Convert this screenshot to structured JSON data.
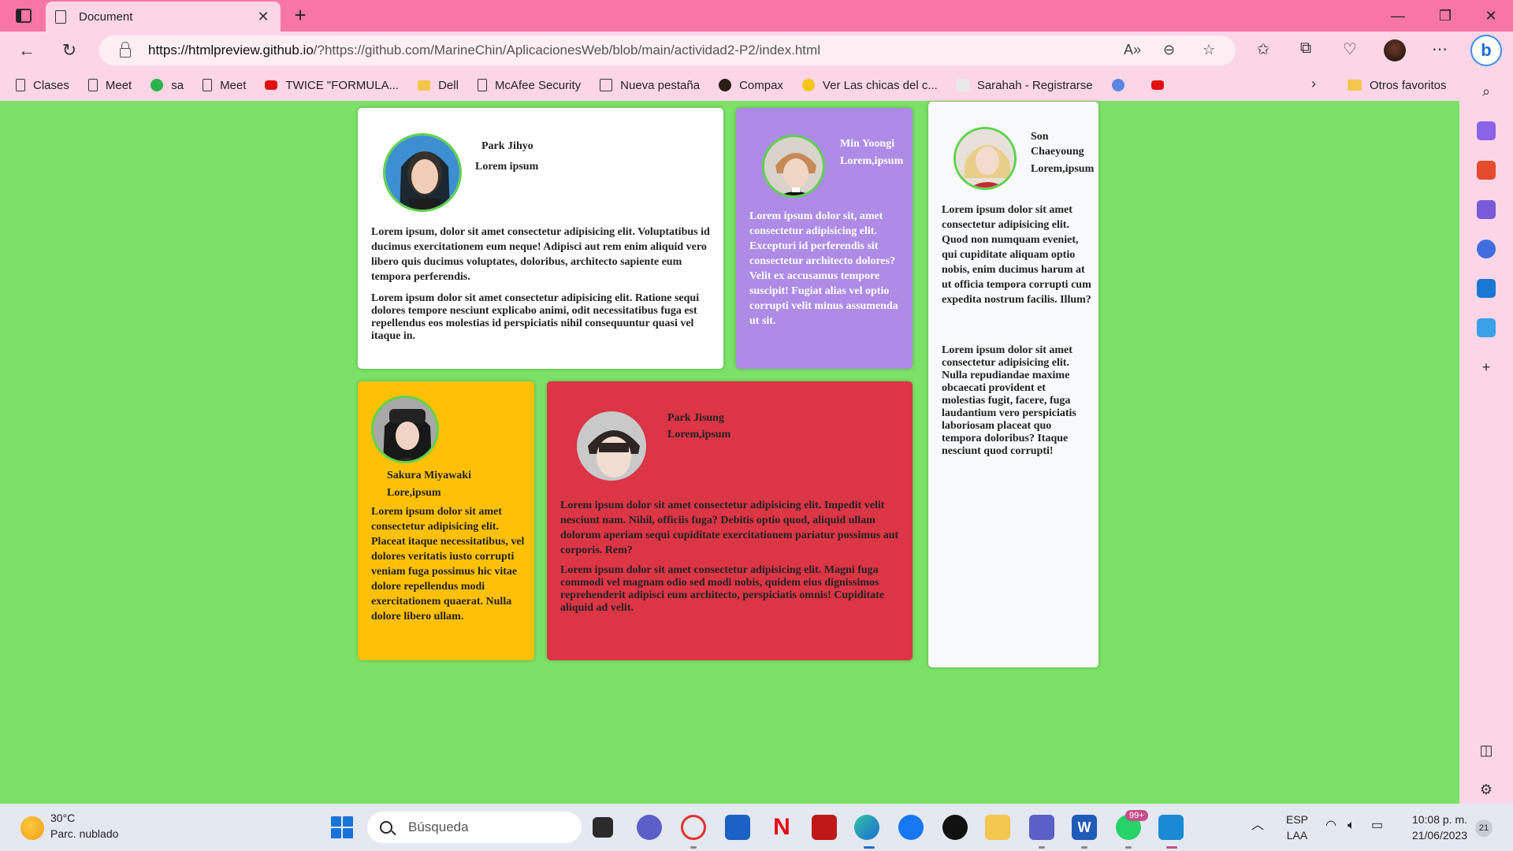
{
  "browser": {
    "tab_title": "Document",
    "url_host": "https://htmlpreview.github.io",
    "url_rest": "/?https://github.com/MarineChin/AplicacionesWeb/blob/main/actividad2-P2/index.html",
    "bookmarks": [
      {
        "label": "Clases",
        "icon": "document-icon"
      },
      {
        "label": "Meet",
        "icon": "document-icon"
      },
      {
        "label": "sa",
        "icon": "green-badge-icon"
      },
      {
        "label": "Meet",
        "icon": "document-icon"
      },
      {
        "label": "TWICE \"FORMULA...",
        "icon": "youtube-icon"
      },
      {
        "label": "Dell",
        "icon": "folder-icon"
      },
      {
        "label": "McAfee Security",
        "icon": "document-icon"
      },
      {
        "label": "Nueva pestaña",
        "icon": "calendar-icon"
      },
      {
        "label": "Compax",
        "icon": "compax-icon"
      },
      {
        "label": "Ver Las chicas del c...",
        "icon": "play-icon"
      },
      {
        "label": "Sarahah - Registrarse",
        "icon": "sarahah-icon"
      },
      {
        "label": "",
        "icon": "blue-play-icon"
      },
      {
        "label": "",
        "icon": "youtube-icon"
      }
    ],
    "other_favorites": "Otros favoritos"
  },
  "cards": {
    "jihyo": {
      "name": "Park Jihyo",
      "role": "Lorem ipsum",
      "p1": "Lorem ipsum, dolor sit amet consectetur adipisicing elit. Voluptatibus id ducimus exercitationem eum neque! Adipisci aut rem enim aliquid vero libero quis ducimus voluptates, doloribus, architecto sapiente eum tempora perferendis.",
      "p2": "Lorem ipsum dolor sit amet consectetur adipisicing elit. Ratione sequi dolores tempore nesciunt explicabo animi, odit necessitatibus fuga est repellendus eos molestias id perspiciatis nihil consequuntur quasi vel itaque in.",
      "bg": "#ffffff"
    },
    "yoongi": {
      "name": "Min Yoongi",
      "role": "Lorem,ipsum",
      "p1": "Lorem ipsum dolor sit, amet consectetur adipisicing elit. Excepturi id perferendis sit consectetur architecto dolores? Velit ex accusamus tempore suscipit! Fugiat alias vel optio corrupti velit minus assumenda ut sit.",
      "bg": "#ad8be6"
    },
    "chaeyoung": {
      "name": "Son Chaeyoung",
      "role": "Lorem,ipsum",
      "p1": "Lorem ipsum dolor sit amet consectetur adipisicing elit. Quod non numquam eveniet, qui cupiditate aliquam optio nobis, enim ducimus harum at ut officia tempora corrupti cum expedita nostrum facilis. Illum?",
      "p2": "Lorem ipsum dolor sit amet consectetur adipisicing elit. Nulla repudiandae maxime obcaecati provident et molestias fugit, facere, fuga laudantium vero perspiciatis laboriosam placeat quo tempora doloribus? Itaque nesciunt quod corrupti!",
      "bg": "#f8f9fa"
    },
    "sakura": {
      "name": "Sakura Miyawaki",
      "role": "Lore,ipsum",
      "p1": "Lorem ipsum dolor sit amet consectetur adipisicing elit. Placeat itaque necessitatibus, vel dolores veritatis iusto corrupti veniam fuga possimus hic vitae dolore repellendus modi exercitationem quaerat. Nulla dolore libero ullam.",
      "bg": "#ffc107"
    },
    "jisung": {
      "name": "Park Jisung",
      "role": "Lorem,ipsum",
      "p1": "Lorem ipsum dolor sit amet consectetur adipisicing elit. Impedit velit nesciunt nam. Nihil, officiis fuga? Debitis optio quod, aliquid ullam dolorum aperiam sequi cupiditate exercitationem pariatur possimus aut corporis. Rem?",
      "p2": "Lorem ipsum dolor sit amet consectetur adipisicing elit. Magni fuga commodi vel magnam odio sed modi nobis, quidem eius dignissimos reprehenderit adipisci eum architecto, perspiciatis omnis! Cupiditate aliquid ad velit.",
      "bg": "#dc3545"
    }
  },
  "taskbar": {
    "temperature": "30°C",
    "condition": "Parc. nublado",
    "search_placeholder": "Búsqueda",
    "whatsapp_badge": "99+",
    "lang_1": "ESP",
    "lang_2": "LAA",
    "time": "10:08 p. m.",
    "date": "21/06/2023",
    "notifications": "21"
  }
}
